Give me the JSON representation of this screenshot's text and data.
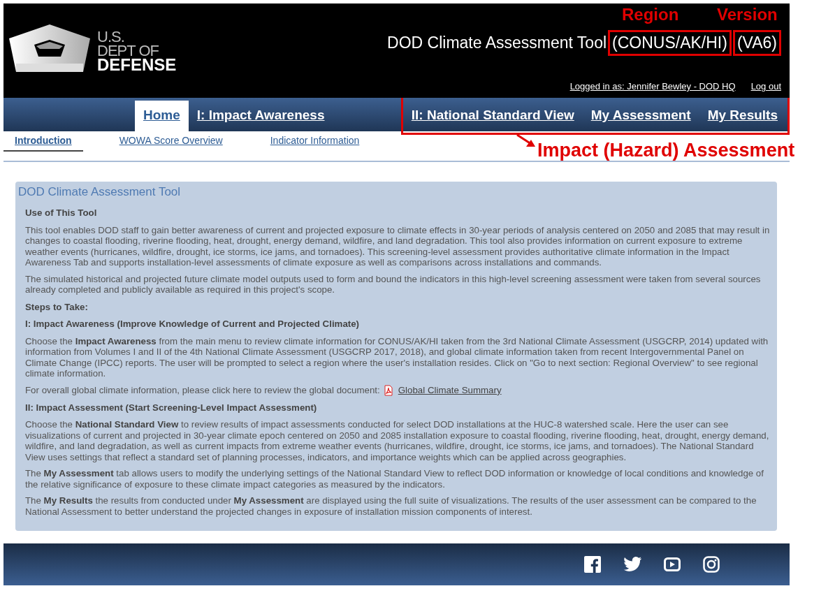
{
  "header": {
    "logo": [
      "U.S.",
      "DEPT OF",
      "DEFENSE"
    ],
    "title": "DOD Climate Assessment Tool",
    "region": "(CONUS/AK/HI)",
    "version": "(VA6)",
    "user": "Logged in as: Jennifer Bewley - DOD HQ",
    "logout": "Log out"
  },
  "main_nav": {
    "items": [
      {
        "label": "Home",
        "selected": true
      },
      {
        "label": "I: Impact Awareness",
        "selected": false
      }
    ],
    "assessment_items": [
      {
        "label": "II: National Standard View",
        "selected": false
      },
      {
        "label": "My Assessment",
        "selected": false
      },
      {
        "label": "My Results",
        "selected": false
      }
    ]
  },
  "sub_nav": [
    {
      "label": "Introduction",
      "selected": true
    },
    {
      "label": "WOWA Score Overview",
      "selected": false
    },
    {
      "label": "Indicator Information",
      "selected": false
    }
  ],
  "panel": {
    "title": "DOD Climate Assessment Tool",
    "blocks": [
      {
        "kind": "heading",
        "text": "Use of This Tool"
      },
      {
        "kind": "paragraph",
        "text": "This tool enables DOD staff to gain better awareness of current and projected exposure to climate effects in 30-year periods of analysis centered on 2050 and 2085 that may result in changes to coastal flooding, riverine flooding, heat, drought, energy demand, wildfire, and land degradation. This tool also provides information on current exposure to extreme weather events (hurricanes, wildfire, drought, ice storms, ice jams, and tornadoes). This screening-level assessment provides authoritative climate information in the Impact Awareness Tab and supports installation-level assessments of climate exposure as well as comparisons across installations and commands."
      },
      {
        "kind": "paragraph",
        "text": "The simulated historical and projected future climate model outputs used to form and bound the indicators in this high-level screening assessment were taken from several sources already completed and publicly available as required in this project's scope."
      },
      {
        "kind": "heading",
        "text": "Steps to Take:"
      },
      {
        "kind": "heading",
        "text": "I: Impact Awareness (Improve Knowledge of Current and Projected Climate)"
      },
      {
        "kind": "paragraph",
        "text": "Choose the **Impact Awareness** from the main menu to review climate information for CONUS/AK/HI taken from the 3rd National Climate Assessment (USGCRP, 2014) updated with information from Volumes I and II of the 4th National Climate Assessment (USGCRP 2017, 2018), and global climate information taken from recent Intergovernmental Panel on Climate Change (IPCC) reports. The user will be prompted to select a region where the user's installation resides. Click on \"Go to next section: Regional Overview\" to see regional climate information."
      },
      {
        "kind": "link_line",
        "text": "For overall global climate information, please click here to review the global document:",
        "link": "Global Climate Summary"
      },
      {
        "kind": "heading",
        "text": "II: Impact Assessment (Start Screening-Level Impact Assessment)"
      },
      {
        "kind": "paragraph",
        "text": "Choose the **National Standard View** to review results of impact assessments conducted for select DOD installations at the HUC-8 watershed scale. Here the user can see visualizations of current and projected in 30-year climate epoch centered on 2050 and 2085 installation exposure to coastal flooding, riverine flooding, heat, drought, energy demand, wildfire, and land degradation, as well as current impacts from extreme weather events (hurricanes, wildfire, drought, ice storms, ice jams, and tornadoes). The National Standard View uses settings that reflect a standard set of planning processes, indicators, and importance weights which can be applied across geographies."
      },
      {
        "kind": "paragraph",
        "text": "The **My Assessment** tab allows users to modify the underlying settings of the National Standard View to reflect DOD information or knowledge of local conditions and knowledge of the relative significance of exposure to these climate impact categories as measured by the indicators."
      },
      {
        "kind": "paragraph",
        "text": "The **My Results** the results from conducted under **My Assessment** are displayed using the full suite of visualizations. The results of the user assessment can be compared to the National Assessment to better understand the projected changes in exposure of installation mission components of interest."
      }
    ]
  },
  "annotations": {
    "region_label": "Region",
    "version_label": "Version",
    "assessment_label": "Impact (Hazard) Assessment"
  }
}
